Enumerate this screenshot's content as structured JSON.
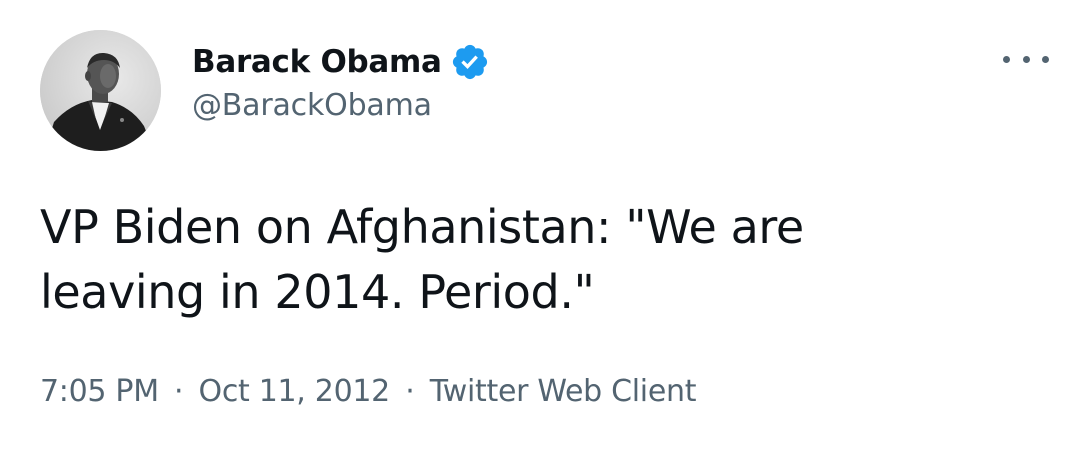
{
  "author": {
    "display_name": "Barack Obama",
    "handle": "@BarackObama",
    "verified": true,
    "verified_color": "#1d9bf0",
    "avatar_icon": "profile-photo"
  },
  "menu": {
    "icon": "more-horizontal-icon"
  },
  "tweet": {
    "text": "VP Biden on Afghanistan: \"We are\nleaving in 2014. Period.\""
  },
  "meta": {
    "time": "7:05 PM",
    "separator": "·",
    "date": "Oct 11, 2012",
    "source": "Twitter Web Client"
  },
  "colors": {
    "text_primary": "#0f1419",
    "text_secondary": "#536471"
  }
}
